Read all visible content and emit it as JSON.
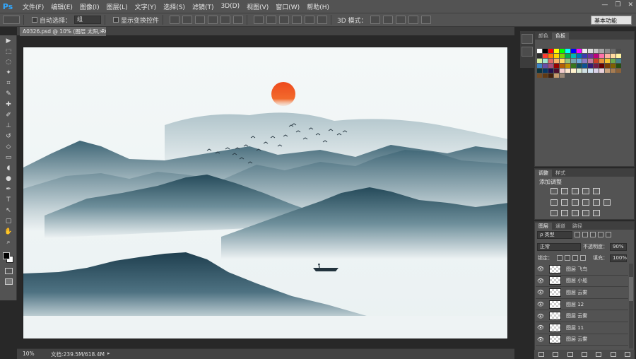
{
  "app": {
    "logo": "Ps",
    "window_controls": [
      "—",
      "❐",
      "✕"
    ]
  },
  "menu": [
    "文件(F)",
    "编辑(E)",
    "图像(I)",
    "图层(L)",
    "文字(Y)",
    "选择(S)",
    "滤镜(T)",
    "3D(D)",
    "视图(V)",
    "窗口(W)",
    "帮助(H)"
  ],
  "options": {
    "auto_select_label": "自动选择：",
    "auto_select_value": "组",
    "show_transform_label": "显示变换控件",
    "mode_3d_label": "3D 模式：",
    "workspace": "基本功能"
  },
  "toolbar_icons": [
    "move-tool-icon",
    "marquee-tool-icon",
    "lasso-tool-icon",
    "magic-wand-icon",
    "crop-tool-icon",
    "eyedropper-icon",
    "healing-brush-icon",
    "brush-tool-icon",
    "clone-stamp-icon",
    "history-brush-icon",
    "eraser-icon",
    "gradient-tool-icon",
    "blur-tool-icon",
    "dodge-tool-icon",
    "pen-tool-icon",
    "type-tool-icon",
    "path-select-icon",
    "shape-tool-icon",
    "hand-tool-icon",
    "zoom-tool-icon"
  ],
  "toolbar_glyphs": [
    "▶",
    "⬚",
    "◌",
    "✦",
    "⌗",
    "✎",
    "✚",
    "✐",
    "⊥",
    "↺",
    "◇",
    "▭",
    "◖",
    "●",
    "✒",
    "T",
    "↖",
    "▢",
    "✋",
    "⌕"
  ],
  "document": {
    "tab_title": "A0326.psd @ 10% (图层 太阳, RGB/8)",
    "close": "×"
  },
  "status": {
    "zoom": "10%",
    "doc_size": "文档:239.5M/618.4M",
    "arrow": "▸"
  },
  "panels": {
    "swatch_tabs": [
      "颜色",
      "色板"
    ],
    "adjust_tabs": [
      "调整",
      "样式"
    ],
    "adjust_title": "添加调整",
    "layers_tabs": [
      "图层",
      "通道",
      "路径"
    ],
    "filter_kind": "ρ 类型",
    "blend_mode": "正常",
    "opacity_label": "不透明度：",
    "opacity_value": "90%",
    "lock_label": "锁定：",
    "fill_label": "填充：",
    "fill_value": "100%",
    "layers": [
      {
        "name": "图层 飞鸟"
      },
      {
        "name": "图层 小船"
      },
      {
        "name": "图层 云雾"
      },
      {
        "name": "图层 12"
      },
      {
        "name": "图层 云雾"
      },
      {
        "name": "图层 11"
      },
      {
        "name": "图层 云雾"
      }
    ]
  },
  "colors": {
    "sun": "#f15a24",
    "mountain_dark": "#2e5566",
    "mist": "#e9f1f2"
  }
}
